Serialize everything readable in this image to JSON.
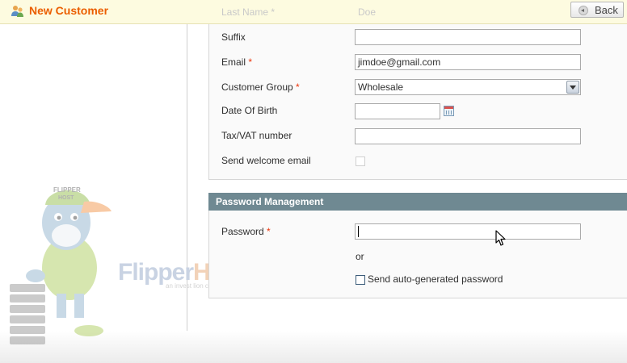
{
  "header": {
    "title": "New Customer",
    "back_label": "Back"
  },
  "form": {
    "last_name": {
      "label": "Last Name",
      "required": "*",
      "value": "Doe"
    },
    "suffix": {
      "label": "Suffix",
      "value": ""
    },
    "email": {
      "label": "Email",
      "required": "*",
      "value": "jimdoe@gmail.com"
    },
    "customer_group": {
      "label": "Customer Group",
      "required": "*",
      "value": "Wholesale"
    },
    "dob": {
      "label": "Date Of Birth",
      "value": ""
    },
    "taxvat": {
      "label": "Tax/VAT number",
      "value": ""
    },
    "welcome": {
      "label": "Send welcome email",
      "checked": false
    }
  },
  "password_section": {
    "title": "Password Management",
    "password": {
      "label": "Password",
      "required": "*",
      "value": ""
    },
    "or_text": "or",
    "autogen_label": "Send auto-generated password",
    "autogen_checked": false
  },
  "watermark": {
    "flipper": "Flipper",
    "host": "Host",
    "tagline": "an invest lion company",
    "cap_text_1": "FLIPPER",
    "cap_text_2": "HOST"
  },
  "icons": {
    "title": "customer-icon",
    "back": "back-arrow-icon",
    "calendar": "calendar-icon",
    "select": "chevron-down-icon",
    "cursor": "mouse-pointer-icon"
  }
}
